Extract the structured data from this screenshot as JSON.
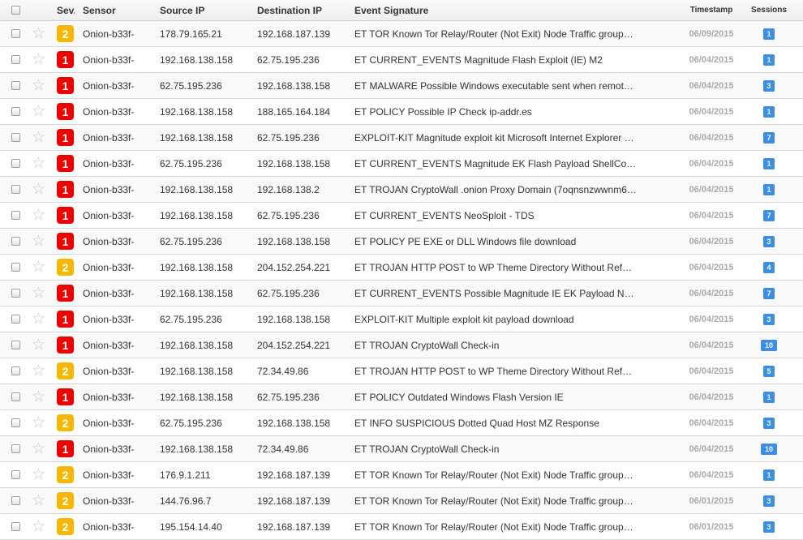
{
  "colors": {
    "sev_high": "#ee0000",
    "sev_medium": "#f5b800",
    "session_badge": "#3a8ee6"
  },
  "header": {
    "sev": "Sev.",
    "sensor": "Sensor",
    "source_ip": "Source IP",
    "destination_ip": "Destination IP",
    "event_signature": "Event Signature",
    "timestamp": "Timestamp",
    "sessions": "Sessions"
  },
  "rows": [
    {
      "sev": "2",
      "sensor": "Onion-b33f-",
      "src": "178.79.165.21",
      "dst": "192.168.187.139",
      "sig": "ET TOR Known Tor Relay/Router (Not Exit) Node Traffic group…",
      "ts": "06/09/2015",
      "sessions": "1"
    },
    {
      "sev": "1",
      "sensor": "Onion-b33f-",
      "src": "192.168.138.158",
      "dst": "62.75.195.236",
      "sig": "ET CURRENT_EVENTS Magnitude Flash Exploit (IE) M2",
      "ts": "06/04/2015",
      "sessions": "1"
    },
    {
      "sev": "1",
      "sensor": "Onion-b33f-",
      "src": "62.75.195.236",
      "dst": "192.168.138.158",
      "sig": "ET MALWARE Possible Windows executable sent when remot…",
      "ts": "06/04/2015",
      "sessions": "3"
    },
    {
      "sev": "1",
      "sensor": "Onion-b33f-",
      "src": "192.168.138.158",
      "dst": "188.165.164.184",
      "sig": "ET POLICY Possible IP Check ip-addr.es",
      "ts": "06/04/2015",
      "sessions": "1"
    },
    {
      "sev": "1",
      "sensor": "Onion-b33f-",
      "src": "192.168.138.158",
      "dst": "62.75.195.236",
      "sig": "EXPLOIT-KIT Magnitude exploit kit Microsoft Internet Explorer …",
      "ts": "06/04/2015",
      "sessions": "7"
    },
    {
      "sev": "1",
      "sensor": "Onion-b33f-",
      "src": "62.75.195.236",
      "dst": "192.168.138.158",
      "sig": "ET CURRENT_EVENTS Magnitude EK Flash Payload ShellCo…",
      "ts": "06/04/2015",
      "sessions": "1"
    },
    {
      "sev": "1",
      "sensor": "Onion-b33f-",
      "src": "192.168.138.158",
      "dst": "192.168.138.2",
      "sig": "ET TROJAN CryptoWall .onion Proxy Domain (7oqnsnzwwnm6…",
      "ts": "06/04/2015",
      "sessions": "1"
    },
    {
      "sev": "1",
      "sensor": "Onion-b33f-",
      "src": "192.168.138.158",
      "dst": "62.75.195.236",
      "sig": "ET CURRENT_EVENTS NeoSploit - TDS",
      "ts": "06/04/2015",
      "sessions": "7"
    },
    {
      "sev": "1",
      "sensor": "Onion-b33f-",
      "src": "62.75.195.236",
      "dst": "192.168.138.158",
      "sig": "ET POLICY PE EXE or DLL Windows file download",
      "ts": "06/04/2015",
      "sessions": "3"
    },
    {
      "sev": "2",
      "sensor": "Onion-b33f-",
      "src": "192.168.138.158",
      "dst": "204.152.254.221",
      "sig": "ET TROJAN HTTP POST to WP Theme Directory Without Ref…",
      "ts": "06/04/2015",
      "sessions": "4"
    },
    {
      "sev": "1",
      "sensor": "Onion-b33f-",
      "src": "192.168.138.158",
      "dst": "62.75.195.236",
      "sig": "ET CURRENT_EVENTS Possible Magnitude IE EK Payload N…",
      "ts": "06/04/2015",
      "sessions": "7"
    },
    {
      "sev": "1",
      "sensor": "Onion-b33f-",
      "src": "62.75.195.236",
      "dst": "192.168.138.158",
      "sig": "EXPLOIT-KIT Multiple exploit kit payload download",
      "ts": "06/04/2015",
      "sessions": "3"
    },
    {
      "sev": "1",
      "sensor": "Onion-b33f-",
      "src": "192.168.138.158",
      "dst": "204.152.254.221",
      "sig": "ET TROJAN CryptoWall Check-in",
      "ts": "06/04/2015",
      "sessions": "10"
    },
    {
      "sev": "2",
      "sensor": "Onion-b33f-",
      "src": "192.168.138.158",
      "dst": "72.34.49.86",
      "sig": "ET TROJAN HTTP POST to WP Theme Directory Without Ref…",
      "ts": "06/04/2015",
      "sessions": "5"
    },
    {
      "sev": "1",
      "sensor": "Onion-b33f-",
      "src": "192.168.138.158",
      "dst": "62.75.195.236",
      "sig": "ET POLICY Outdated Windows Flash Version IE",
      "ts": "06/04/2015",
      "sessions": "1"
    },
    {
      "sev": "2",
      "sensor": "Onion-b33f-",
      "src": "62.75.195.236",
      "dst": "192.168.138.158",
      "sig": "ET INFO SUSPICIOUS Dotted Quad Host MZ Response",
      "ts": "06/04/2015",
      "sessions": "3"
    },
    {
      "sev": "1",
      "sensor": "Onion-b33f-",
      "src": "192.168.138.158",
      "dst": "72.34.49.86",
      "sig": "ET TROJAN CryptoWall Check-in",
      "ts": "06/04/2015",
      "sessions": "10"
    },
    {
      "sev": "2",
      "sensor": "Onion-b33f-",
      "src": "176.9.1.211",
      "dst": "192.168.187.139",
      "sig": "ET TOR Known Tor Relay/Router (Not Exit) Node Traffic group…",
      "ts": "06/04/2015",
      "sessions": "1"
    },
    {
      "sev": "2",
      "sensor": "Onion-b33f-",
      "src": "144.76.96.7",
      "dst": "192.168.187.139",
      "sig": "ET TOR Known Tor Relay/Router (Not Exit) Node Traffic group…",
      "ts": "06/01/2015",
      "sessions": "3"
    },
    {
      "sev": "2",
      "sensor": "Onion-b33f-",
      "src": "195.154.14.40",
      "dst": "192.168.187.139",
      "sig": "ET TOR Known Tor Relay/Router (Not Exit) Node Traffic group…",
      "ts": "06/01/2015",
      "sessions": "3"
    }
  ]
}
